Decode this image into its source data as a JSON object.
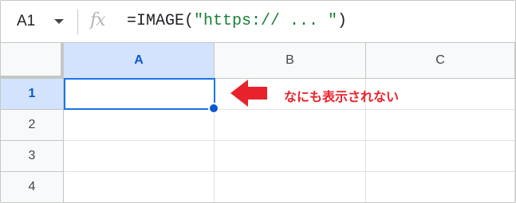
{
  "formula_bar": {
    "cell_reference": "A1",
    "fx_label": "fx",
    "formula_prefix": "=IMAGE(",
    "formula_argument": "\"https:// ... \"",
    "formula_suffix": ")"
  },
  "grid": {
    "columns": [
      "A",
      "B",
      "C"
    ],
    "rows": [
      "1",
      "2",
      "3",
      "4"
    ],
    "selected_column": "A",
    "selected_row": "1"
  },
  "annotation": {
    "text": "なにも表示されない",
    "color": "#e8222b"
  },
  "colors": {
    "selection_blue": "#1a73e8",
    "header_selected_bg": "#d3e3fd",
    "string_green": "#188038"
  }
}
